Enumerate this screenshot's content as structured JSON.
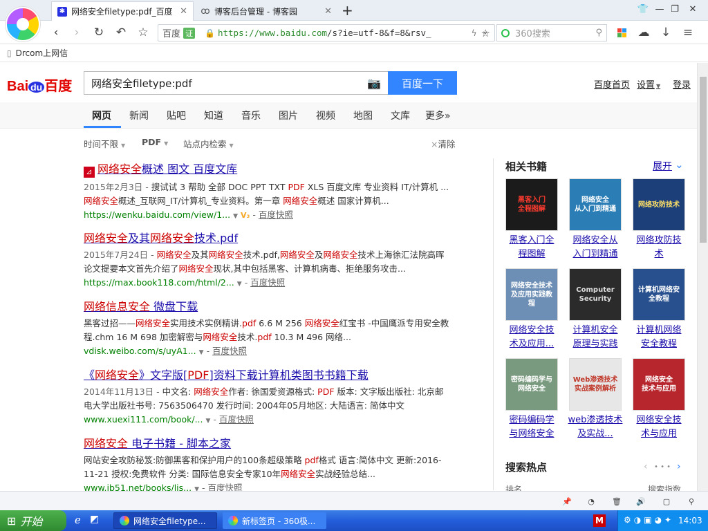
{
  "browser": {
    "tabs": [
      {
        "label": "网络安全filetype:pdf_百度",
        "icon": "baidu-paw-icon",
        "active": true
      },
      {
        "label": "博客后台管理 - 博客园",
        "icon": "cnblogs-icon",
        "active": false
      }
    ],
    "new_tab": "+",
    "address_site": "百度",
    "address_cert": "证",
    "address_url_host": "https://www.baidu.com",
    "address_url_rest": "/s?ie=utf-8&f=8&rsv_",
    "search_placeholder": "360搜索",
    "bookmark": "Drcom上网信"
  },
  "baidu": {
    "logo_text_1": "Bai",
    "logo_text_2": "du",
    "logo_text_3": "百度",
    "query": "网络安全filetype:pdf",
    "search_button": "百度一下",
    "top_links": [
      "百度首页",
      "设置",
      "登录"
    ],
    "tabs": [
      "网页",
      "新闻",
      "贴吧",
      "知道",
      "音乐",
      "图片",
      "视频",
      "地图",
      "文库",
      "更多»"
    ],
    "filters": [
      "时间不限",
      "PDF",
      "站点内检索"
    ],
    "clear": "清除",
    "snapshot_label": "百度快照",
    "results": [
      {
        "title_parts": [
          [
            "网络安全",
            true
          ],
          [
            "概述 图文 百度文库",
            false
          ]
        ],
        "desc": [
          [
            "2015年2月3日 - ",
            "date"
          ],
          [
            "搜试试 3 帮助 全部 DOC PPT TXT ",
            ""
          ],
          [
            "PDF",
            "em"
          ],
          [
            " XLS 百度文库 专业资料 IT/计算机 ...",
            ""
          ]
        ],
        "desc2": [
          [
            "网络安全",
            "em"
          ],
          [
            "概述_互联网_IT/计算机_专业资料。第一章 ",
            ""
          ],
          [
            "网络安全",
            "em"
          ],
          [
            "概述 国家计算机...",
            ""
          ]
        ],
        "url": "https://wenku.baidu.com/view/1..."
      },
      {
        "title_parts": [
          [
            "网络安全",
            true
          ],
          [
            "及其",
            false
          ],
          [
            "网络安全",
            true
          ],
          [
            "技术.pdf",
            false
          ]
        ],
        "desc": [
          [
            "2015年7月24日 - ",
            "date"
          ],
          [
            "网络安全",
            "em"
          ],
          [
            "及其",
            ""
          ],
          [
            "网络安全",
            "em"
          ],
          [
            "技术.pdf,",
            ""
          ],
          [
            "网络安全",
            "em"
          ],
          [
            "及",
            ""
          ],
          [
            "网络安全",
            "em"
          ],
          [
            "技术上海徐汇法院高晖",
            ""
          ]
        ],
        "desc2": [
          [
            "论文提要本文首先介绍了",
            ""
          ],
          [
            "网络安全",
            "em"
          ],
          [
            "现状,其中包括黑客、计算机病毒、拒绝服务攻击...",
            ""
          ]
        ],
        "url": "https://max.book118.com/html/2..."
      },
      {
        "title_parts": [
          [
            "网络信息安全",
            true
          ],
          [
            " 微盘下载",
            false
          ]
        ],
        "desc": [
          [
            "黑客过招——",
            ""
          ],
          [
            "网络安全",
            "em"
          ],
          [
            "实用技术实例精讲.",
            ""
          ],
          [
            "pdf",
            "em"
          ],
          [
            " 6.6 M 256 ",
            ""
          ],
          [
            "网络安全",
            "em"
          ],
          [
            "红宝书 -中国鹰派专用安全教",
            ""
          ]
        ],
        "desc2": [
          [
            "程.chm 16 M 698 加密解密与",
            ""
          ],
          [
            "网络安全",
            "em"
          ],
          [
            "技术.",
            ""
          ],
          [
            "pdf",
            "em"
          ],
          [
            " 10.3 M 496 网络...",
            ""
          ]
        ],
        "url": "vdisk.weibo.com/s/uyA1..."
      },
      {
        "title_parts": [
          [
            "《",
            false
          ],
          [
            "网络安全",
            true
          ],
          [
            "》文字版[",
            false
          ],
          [
            "PDF",
            true
          ],
          [
            "]资料下载计算机类图书书籍下载",
            false
          ]
        ],
        "desc": [
          [
            "2014年11月13日 - ",
            "date"
          ],
          [
            "中文名: ",
            ""
          ],
          [
            "网络安全",
            "em"
          ],
          [
            "作者: 徐国爱资源格式: ",
            ""
          ],
          [
            "PDF",
            "em"
          ],
          [
            " 版本: 文字版出版社: 北京邮",
            ""
          ]
        ],
        "desc2": [
          [
            "电大学出版社书号: 7563506470 发行时间: 2004年05月地区: 大陆语言: 简体中文",
            ""
          ]
        ],
        "url": "www.xuexi111.com/book/..."
      },
      {
        "title_parts": [
          [
            "网络安全",
            true
          ],
          [
            " 电子书籍 - 脚本之家",
            false
          ]
        ],
        "desc": [
          [
            "网站安全攻防秘笈:防御黑客和保护用户的100条超级策略 ",
            ""
          ],
          [
            "pdf",
            "em"
          ],
          [
            "格式 语言:简体中文 更新:2016-",
            ""
          ]
        ],
        "desc2": [
          [
            "11-21 授权:免费软件 分类: 国际信息安全专家10年",
            ""
          ],
          [
            "网络安全",
            "em"
          ],
          [
            "实战经验总结...",
            ""
          ]
        ],
        "url": "www.jb51.net/books/lis..."
      }
    ],
    "sidebar": {
      "books_title": "相关书籍",
      "expand": "展开",
      "books": [
        {
          "title": "黑客入门全程图解",
          "cover_text": "黑客入门\n全程图解",
          "bg": "#1b1b1b",
          "fg": "#ff3b2f"
        },
        {
          "title": "网络安全从入门到精通",
          "cover_text": "网络安全\n从入门到精通",
          "bg": "#2a7db5",
          "fg": "#ffffff"
        },
        {
          "title": "网络攻防技术",
          "cover_text": "网络攻防技术",
          "bg": "#1c3f7a",
          "fg": "#ffe066"
        },
        {
          "title": "网络安全技术及应用...",
          "cover_text": "网络安全技术\n及应用实践教程",
          "bg": "#6e8fb5",
          "fg": "#ffffff"
        },
        {
          "title": "计算机安全原理与实践",
          "cover_text": "Computer\nSecurity",
          "bg": "#2b2b2b",
          "fg": "#dddddd"
        },
        {
          "title": "计算机网络安全教程",
          "cover_text": "计算机网络安全教程",
          "bg": "#28508f",
          "fg": "#ffffff"
        },
        {
          "title": "密码编码学与网络安全",
          "cover_text": "密码编码学与网络安全",
          "bg": "#7a9a7f",
          "fg": "#ffffff"
        },
        {
          "title": "web渗透技术及实战...",
          "cover_text": "Web渗透技术\n实战案例解析",
          "bg": "#e7e7e7",
          "fg": "#c0392b"
        },
        {
          "title": "网络安全技术与应用",
          "cover_text": "网络安全\n技术与应用",
          "bg": "#b8262d",
          "fg": "#ffffff"
        }
      ],
      "book_title_lines": [
        [
          "黑客入门全",
          "程图解"
        ],
        [
          "网络安全从",
          "入门到精通"
        ],
        [
          "网络攻防技",
          "术"
        ],
        [
          "网络安全技",
          "术及应用..."
        ],
        [
          "计算机安全",
          "原理与实践"
        ],
        [
          "计算机网络",
          "安全教程"
        ],
        [
          "密码编码学",
          "与网络安全"
        ],
        [
          "web渗透技术",
          "及实战..."
        ],
        [
          "网络安全技",
          "术与应用"
        ]
      ],
      "hot_title": "搜索热点",
      "hot_col1": "排名",
      "hot_col2": "搜索指数"
    }
  },
  "taskbar": {
    "start": "开始",
    "tasks": [
      "网络安全filetype...",
      "新标签页 - 360极..."
    ],
    "clock": "14:03"
  }
}
